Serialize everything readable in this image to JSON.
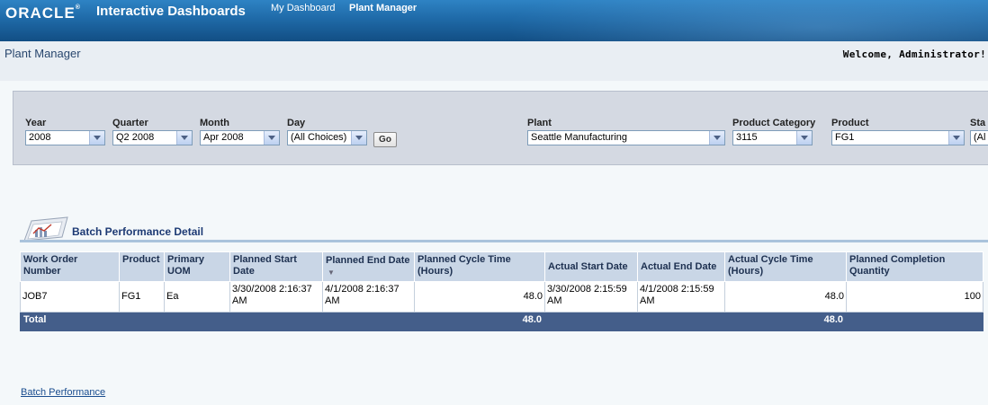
{
  "header": {
    "logo": "ORACLE",
    "app_title": "Interactive Dashboards",
    "nav": [
      "My Dashboard",
      "Plant Manager"
    ]
  },
  "page": {
    "title": "Plant Manager",
    "welcome": "Welcome, Administrator!"
  },
  "prompts": {
    "year": {
      "label": "Year",
      "value": "2008"
    },
    "quarter": {
      "label": "Quarter",
      "value": "Q2 2008"
    },
    "month": {
      "label": "Month",
      "value": "Apr 2008"
    },
    "day": {
      "label": "Day",
      "value": "(All Choices)"
    },
    "go_label": "Go",
    "plant": {
      "label": "Plant",
      "value": "Seattle Manufacturing"
    },
    "product_category": {
      "label": "Product Category",
      "value": "3115"
    },
    "product": {
      "label": "Product",
      "value": "FG1"
    },
    "status": {
      "label": "Sta",
      "value": "(Al"
    }
  },
  "report": {
    "title": "Batch Performance Detail",
    "columns": [
      "Work Order Number",
      "Product",
      "Primary UOM",
      "Planned Start Date",
      "Planned End Date",
      "Planned Cycle Time (Hours)",
      "Actual Start Date",
      "Actual End Date",
      "Actual Cycle Time (Hours)",
      "Planned Completion Quantity"
    ],
    "rows": [
      {
        "work_order": "JOB7",
        "product": "FG1",
        "uom": "Ea",
        "planned_start": "3/30/2008 2:16:37 AM",
        "planned_end": "4/1/2008 2:16:37 AM",
        "planned_cycle": "48.0",
        "actual_start": "3/30/2008 2:15:59 AM",
        "actual_end": "4/1/2008 2:15:59 AM",
        "actual_cycle": "48.0",
        "planned_qty": "100"
      }
    ],
    "total": {
      "label": "Total",
      "planned_cycle": "48.0",
      "actual_cycle": "48.0"
    }
  },
  "footer": {
    "link": "Batch Performance"
  }
}
